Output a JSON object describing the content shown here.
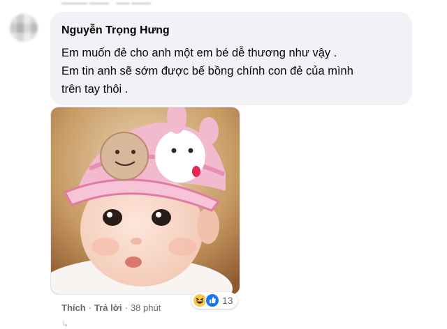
{
  "comment": {
    "author": "Nguyễn Trọng Hưng",
    "lines": [
      "Em muốn đẻ cho anh một em bé dễ thương như vậy .",
      "Em tin anh sẽ sớm được bế bồng chính con đẻ của mình",
      "trên tay thôi ."
    ],
    "actions": {
      "like": "Thích",
      "reply": "Trả lời",
      "separator": "·",
      "time": "38 phút"
    },
    "reactions": {
      "count": "13",
      "icons": [
        "haha-icon",
        "like-icon"
      ]
    }
  },
  "colors": {
    "bubble": "#f0f2f5",
    "text": "#050505",
    "meta": "#65676b",
    "like_blue": "#1877f2",
    "haha_yellow": "#f7c947"
  }
}
